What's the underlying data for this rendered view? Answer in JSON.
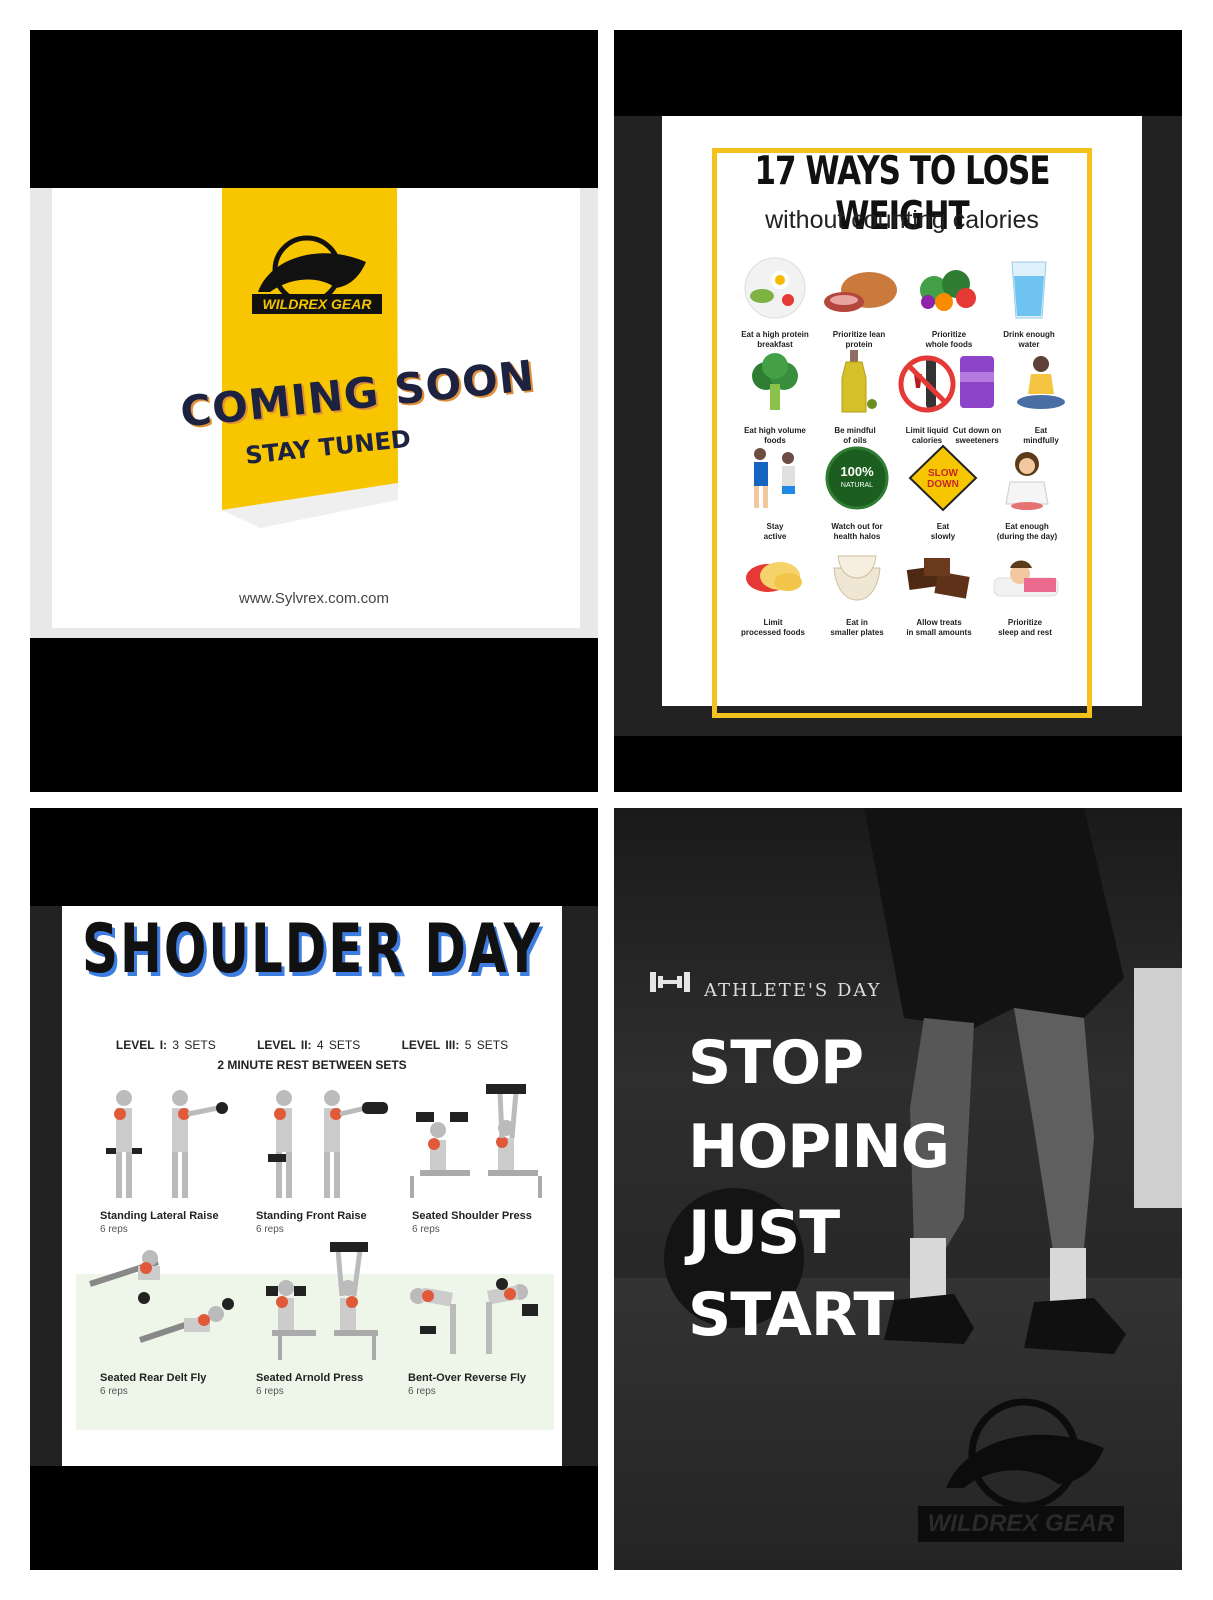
{
  "panel1": {
    "brand": "WILDREX GEAR",
    "headline": "COMING SOON",
    "subline": "STAY TUNED",
    "url": "www.Sylvrex.com.com",
    "colors": {
      "accent": "#f8c600",
      "navy": "#1c2240"
    }
  },
  "panel2": {
    "title": "17 WAYS TO LOSE WEIGHT",
    "subtitle": "without counting calories",
    "items": [
      {
        "l1": "Eat a high protein",
        "l2": "breakfast",
        "icon": "plate-icon"
      },
      {
        "l1": "Prioritize lean",
        "l2": "protein",
        "icon": "meat-icon"
      },
      {
        "l1": "Prioritize",
        "l2": "whole foods",
        "icon": "vegetables-icon"
      },
      {
        "l1": "Drink enough",
        "l2": "water",
        "icon": "water-glass-icon"
      },
      {
        "l1": "Eat high volume",
        "l2": "foods",
        "icon": "broccoli-icon"
      },
      {
        "l1": "Be mindful",
        "l2": "of oils",
        "icon": "oil-bottle-icon"
      },
      {
        "l1": "Limit liquid",
        "l2": "calories",
        "icon": "no-wine-icon"
      },
      {
        "l1": "Cut down on",
        "l2": "sweeteners",
        "icon": "sweetener-pack-icon"
      },
      {
        "l1": "Eat",
        "l2": "mindfully",
        "icon": "meditation-icon"
      },
      {
        "l1": "Stay",
        "l2": "active",
        "icon": "runners-icon"
      },
      {
        "l1": "Watch out for",
        "l2": "health halos",
        "icon": "natural-badge-icon"
      },
      {
        "l1": "Eat",
        "l2": "slowly",
        "icon": "slow-down-sign-icon"
      },
      {
        "l1": "Eat enough",
        "l2": "(during the day)",
        "icon": "woman-eating-icon"
      },
      {
        "l1": "Limit",
        "l2": "processed foods",
        "icon": "chips-icon"
      },
      {
        "l1": "Eat in",
        "l2": "smaller plates",
        "icon": "bowls-icon"
      },
      {
        "l1": "Allow treats",
        "l2": "in small amounts",
        "icon": "chocolate-icon"
      },
      {
        "l1": "Prioritize",
        "l2": "sleep and rest",
        "icon": "sleeping-icon"
      }
    ],
    "badge_text": "100%",
    "badge_sub": "NATURAL",
    "sign_l1": "SLOW",
    "sign_l2": "DOWN"
  },
  "panel3": {
    "title": "SHOULDER DAY",
    "levels": [
      {
        "label": "LEVEL I:",
        "value": "3 SETS"
      },
      {
        "label": "LEVEL II:",
        "value": "4 SETS"
      },
      {
        "label": "LEVEL III:",
        "value": "5 SETS"
      }
    ],
    "rest": "2 MINUTE REST BETWEEN SETS",
    "exercises": [
      {
        "name": "Standing Lateral Raise",
        "reps": "6 reps"
      },
      {
        "name": "Standing Front Raise",
        "reps": "6 reps"
      },
      {
        "name": "Seated Shoulder Press",
        "reps": "6 reps"
      },
      {
        "name": "Seated Rear Delt Fly",
        "reps": "6 reps"
      },
      {
        "name": "Seated Arnold Press",
        "reps": "6 reps"
      },
      {
        "name": "Bent-Over Reverse Fly",
        "reps": "6 reps"
      }
    ]
  },
  "panel4": {
    "tag": "ATHLETE'S DAY",
    "lines": [
      "STOP",
      "HOPING",
      "JUST",
      "START"
    ],
    "brand": "WILDREX GEAR"
  }
}
